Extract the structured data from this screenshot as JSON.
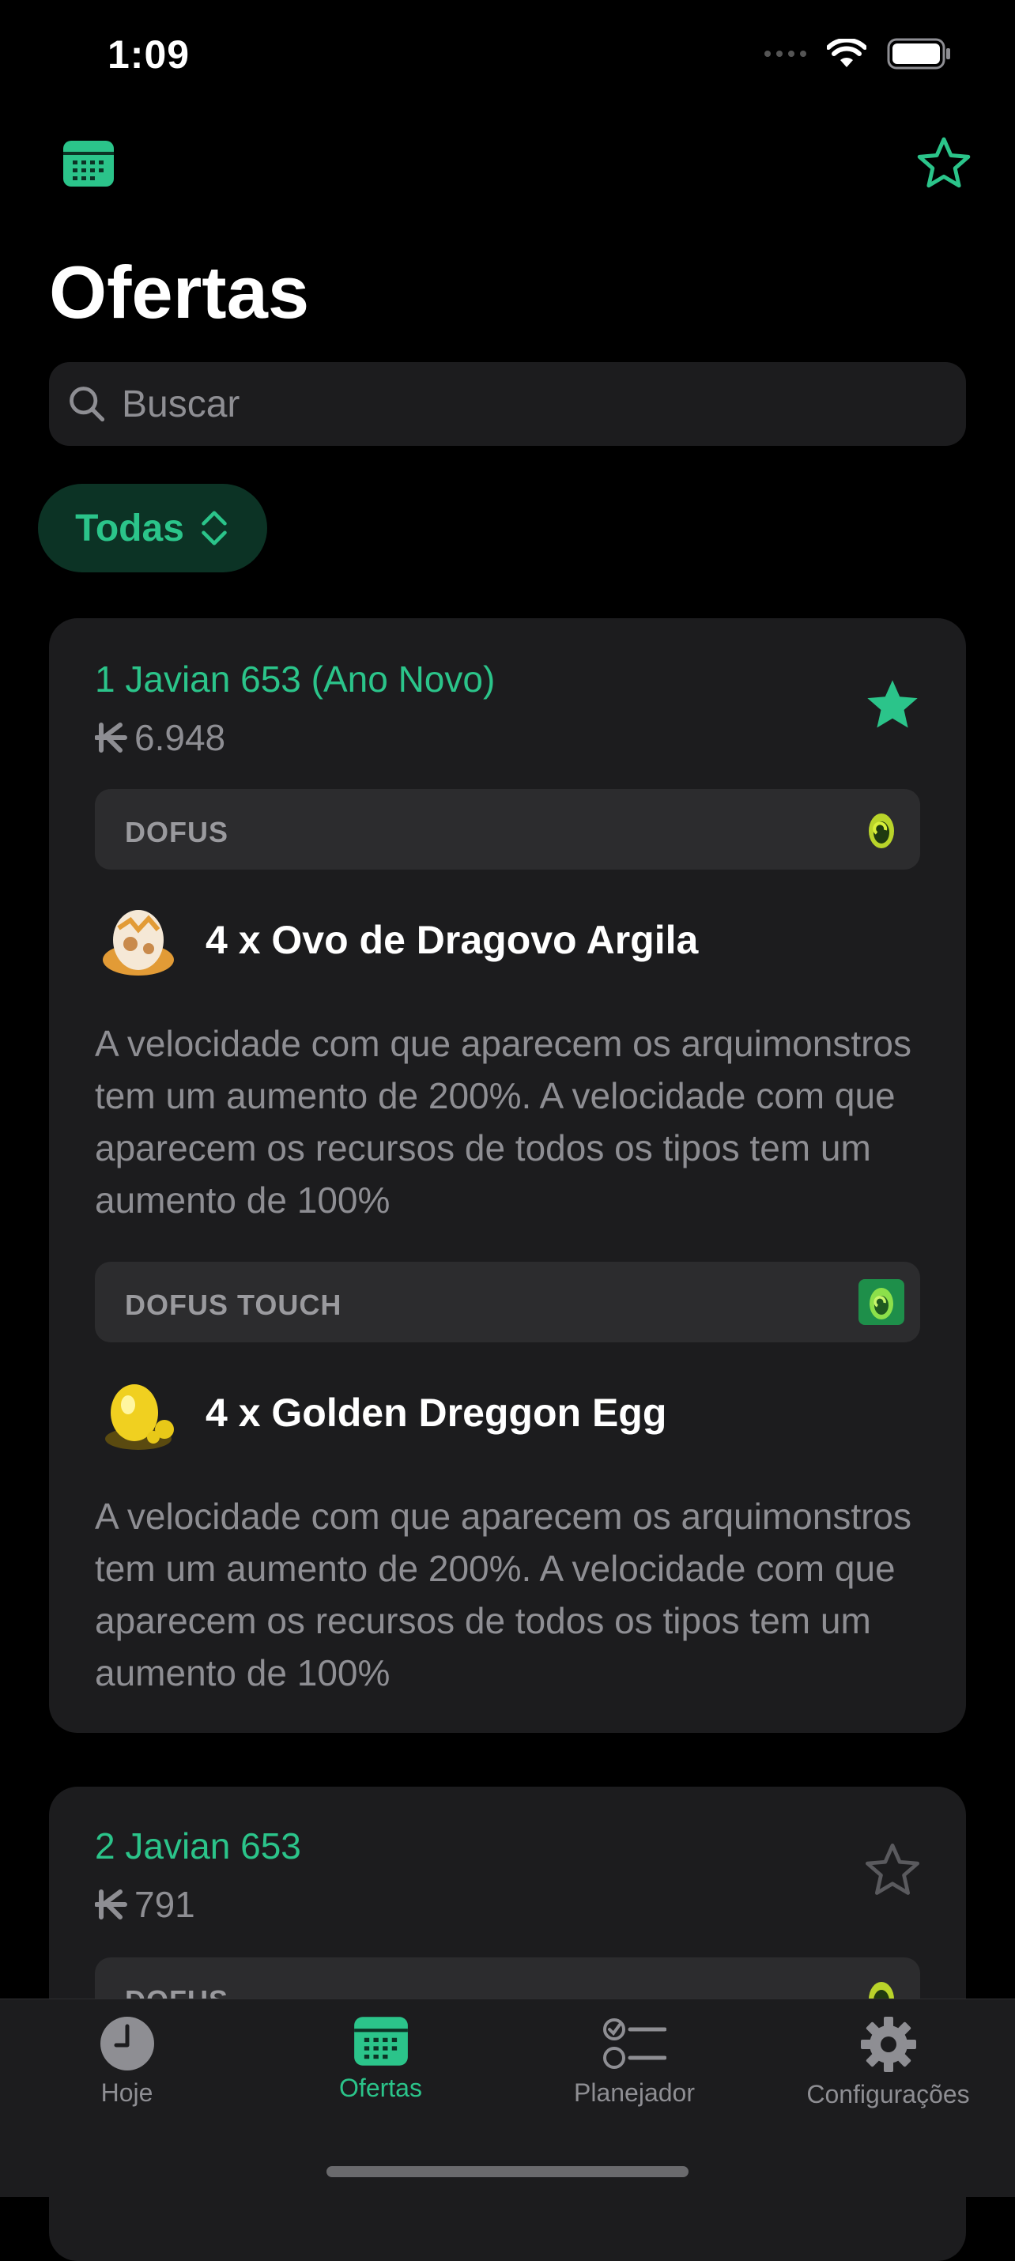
{
  "status": {
    "time": "1:09"
  },
  "header": {
    "title": "Ofertas"
  },
  "search": {
    "placeholder": "Buscar"
  },
  "filter": {
    "label": "Todas"
  },
  "offers": [
    {
      "date": "1 Javian 653 (Ano Novo)",
      "price": "6.948",
      "favorite": true,
      "games": [
        {
          "label": "DOFUS",
          "item": "4 x Ovo de Dragovo Argila",
          "description": "A velocidade com que aparecem os arquimonstros tem um aumento de 200%. A velocidade com que aparecem os recursos de todos os tipos tem um aumento de 100%"
        },
        {
          "label": "DOFUS TOUCH",
          "item": "4 x Golden Dreggon Egg",
          "description": "A velocidade com que aparecem os arquimonstros tem um aumento de 200%. A velocidade com que aparecem os recursos de todos os tipos tem um aumento de 100%"
        }
      ]
    },
    {
      "date": "2 Javian 653",
      "price": "791",
      "favorite": false,
      "games": [
        {
          "label": "DOFUS"
        }
      ]
    }
  ],
  "tabs": [
    {
      "label": "Hoje",
      "icon": "clock-icon"
    },
    {
      "label": "Ofertas",
      "icon": "calendar-icon"
    },
    {
      "label": "Planejador",
      "icon": "checklist-icon"
    },
    {
      "label": "Configurações",
      "icon": "gear-icon"
    }
  ],
  "colors": {
    "accent": "#2bc48a",
    "card": "#1c1c1e",
    "secondaryText": "#8e8e93"
  }
}
